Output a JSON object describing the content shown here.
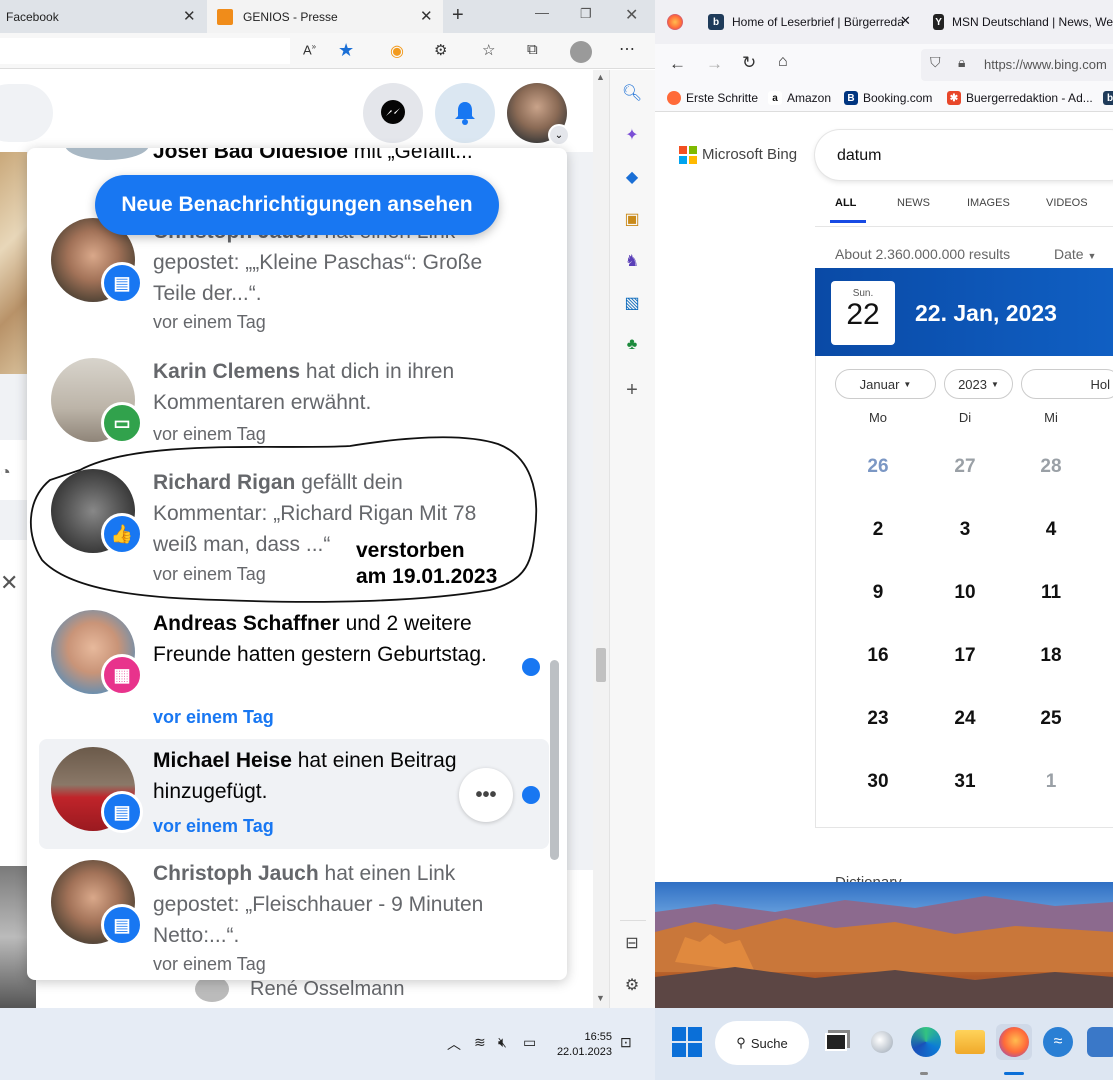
{
  "edge": {
    "tabs": [
      {
        "title": "Facebook"
      },
      {
        "title": "GENIOS - Presse"
      }
    ]
  },
  "facebook": {
    "new_notifications_button": "Neue Benachrichtigungen ansehen",
    "top_partial": {
      "name": "Josef Bad Oldesloe",
      "text": " mit „Gefällt..."
    },
    "notifications": [
      {
        "name": "Christoph Jauch",
        "text": " hat einen Link gepostet: „„Kleine Paschas“: Große Teile der...“.",
        "time": "vor einem Tag",
        "read": true,
        "badge": "comment"
      },
      {
        "name": "Karin Clemens",
        "text": " hat dich in ihren Kommentaren erwähnt.",
        "time": "vor einem Tag",
        "read": true,
        "badge": "mention"
      },
      {
        "name": "Richard Rigan",
        "text": " gefällt dein Kommentar: „Richard Rigan Mit 78 weiß man, dass ...“",
        "time": "vor einem Tag",
        "read": true,
        "badge": "like"
      },
      {
        "name": "Andreas Schaffner",
        "text": " und 2 weitere Freunde hatten gestern Geburtstag.",
        "time": "vor einem Tag",
        "read": false,
        "badge": "birthday"
      },
      {
        "name": "Michael Heise",
        "text": " hat einen Beitrag hinzugefügt.",
        "time": "vor einem Tag",
        "read": false,
        "badge": "post"
      },
      {
        "name": "Christoph Jauch",
        "text": " hat einen Link gepostet: „Fleischhauer - 9 Minuten Netto:...“.",
        "time": "vor einem Tag",
        "read": true,
        "badge": "comment"
      }
    ],
    "annotation": {
      "line1": "verstorben",
      "line2": "am 19.01.2023"
    },
    "behind_name": "René Osselmann"
  },
  "firefox": {
    "tabs": [
      {
        "title": "Home of Leserbrief | Bürgerreda"
      },
      {
        "title": "MSN Deutschland | News, We"
      }
    ],
    "url": "https://www.bing.com",
    "bookmarks": [
      "Erste Schritte",
      "Amazon",
      "Booking.com",
      "Buergerredaktion - Ad..."
    ]
  },
  "bing": {
    "logo": "Microsoft Bing",
    "query": "datum",
    "tabs": [
      "ALL",
      "NEWS",
      "IMAGES",
      "VIDEOS"
    ],
    "results_count": "About 2.360.000.000 results",
    "date_filter": "Date",
    "calendar": {
      "day_abbr": "Sun.",
      "day_num": "22",
      "full_date": "22. Jan, 2023",
      "month_select": "Januar",
      "year_select": "2023",
      "holiday_select": "Hol",
      "weekday_headers": [
        "Mo",
        "Di",
        "Mi"
      ],
      "rows": [
        [
          "26",
          "27",
          "28"
        ],
        [
          "2",
          "3",
          "4"
        ],
        [
          "9",
          "10",
          "11"
        ],
        [
          "16",
          "17",
          "18"
        ],
        [
          "23",
          "24",
          "25"
        ],
        [
          "30",
          "31",
          "1"
        ]
      ]
    },
    "dictionary_label": "Dictionary"
  },
  "taskbar": {
    "time": "16:55",
    "date": "22.01.2023",
    "search_label": "Suche"
  }
}
